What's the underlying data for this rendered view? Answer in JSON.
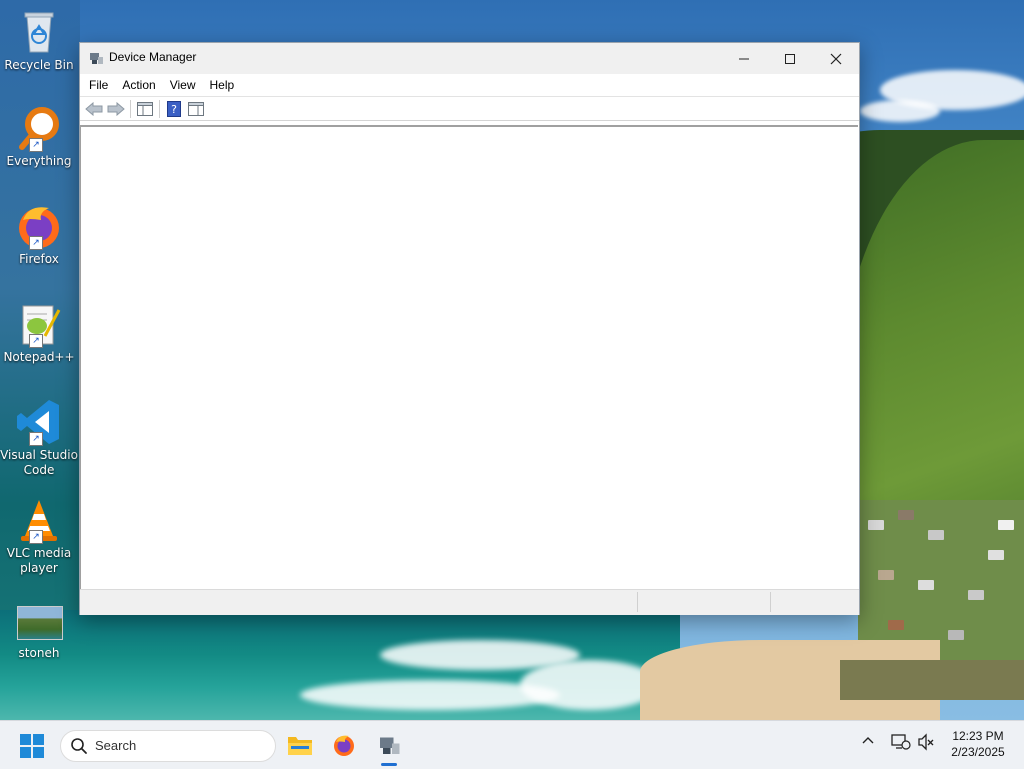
{
  "desktop": {
    "icons": [
      {
        "label": "Recycle Bin"
      },
      {
        "label": "Everything"
      },
      {
        "label": "Firefox"
      },
      {
        "label": "Notepad++"
      },
      {
        "label": "Visual Studio Code"
      },
      {
        "label": "VLC media player"
      },
      {
        "label": "stoneh"
      }
    ]
  },
  "window": {
    "title": "Device Manager",
    "menu": [
      "File",
      "Action",
      "View",
      "Help"
    ]
  },
  "taskbar": {
    "search_label": "Search",
    "time": "12:23 PM",
    "date": "2/23/2025",
    "accent": "#1f6fd1"
  }
}
